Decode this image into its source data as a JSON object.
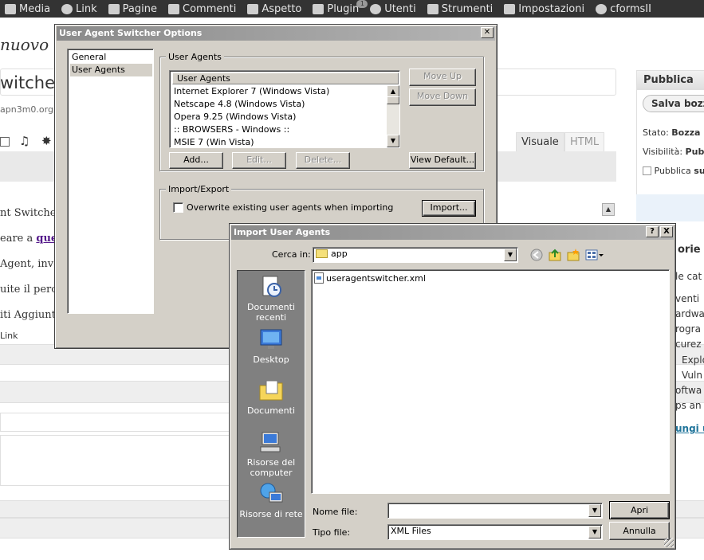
{
  "adminbar": {
    "items": [
      "Media",
      "Link",
      "Pagine",
      "Commenti",
      "Aspetto",
      "Plugin",
      "Utenti",
      "Strumenti",
      "Impostazioni",
      "cformsII"
    ],
    "plugin_badge": "1"
  },
  "background": {
    "heading_fragment": "nuovo a",
    "title_fragment": "witche",
    "permalink_fragment": "apn3m0.org",
    "publish_box_title": "Pubblica",
    "save_draft": "Salva bozz",
    "status_label": "Stato:",
    "status_value": "Bozza",
    "visibility_label": "Visibilità:",
    "visibility_value": "Pub",
    "publish_label": "Pubblica",
    "publish_value": "su",
    "tab_visual": "Visuale",
    "tab_html": "HTML",
    "content_lines": [
      "nt Switcher",
      "eare a ",
      "Agent, inve",
      "uite il perco",
      "iti Aggiunti"
    ],
    "content_link": "ques",
    "link_row": "Link",
    "categories_title": "orie",
    "categories": [
      "le cat",
      "venti",
      "ardwa",
      "rogra",
      "curez",
      "Explo",
      "Vuln",
      "oftwa",
      "ps an"
    ],
    "add_category": "ungi u"
  },
  "options_dialog": {
    "title": "User Agent Switcher Options",
    "nav": [
      "General",
      "User Agents"
    ],
    "selected_nav": "User Agents",
    "ua_group_label": "User Agents",
    "list_header": "User Agents",
    "agents": [
      "Internet Explorer 7 (Windows Vista)",
      "Netscape 4.8 (Windows Vista)",
      "Opera 9.25 (Windows Vista)",
      ":: BROWSERS - Windows ::",
      "MSIE 7 (Win Vista)"
    ],
    "move_up": "Move Up",
    "move_down": "Move Down",
    "add": "Add...",
    "edit": "Edit...",
    "delete": "Delete...",
    "view_default": "View Default...",
    "import_export_label": "Import/Export",
    "overwrite_label": "Overwrite existing user agents when importing",
    "overwrite_checked": false,
    "import": "Import..."
  },
  "import_dialog": {
    "title": "Import User Agents",
    "help_btn": "?",
    "close_btn": "X",
    "look_in_label": "Cerca in:",
    "look_in_value": "app",
    "places": [
      "Documenti recenti",
      "Desktop",
      "Documenti",
      "Risorse del computer",
      "Risorse di rete"
    ],
    "files": [
      "useragentswitcher.xml"
    ],
    "filename_label": "Nome file:",
    "filename_value": "",
    "filetype_label": "Tipo file:",
    "filetype_value": "XML Files",
    "open": "Apri",
    "cancel": "Annulla"
  }
}
